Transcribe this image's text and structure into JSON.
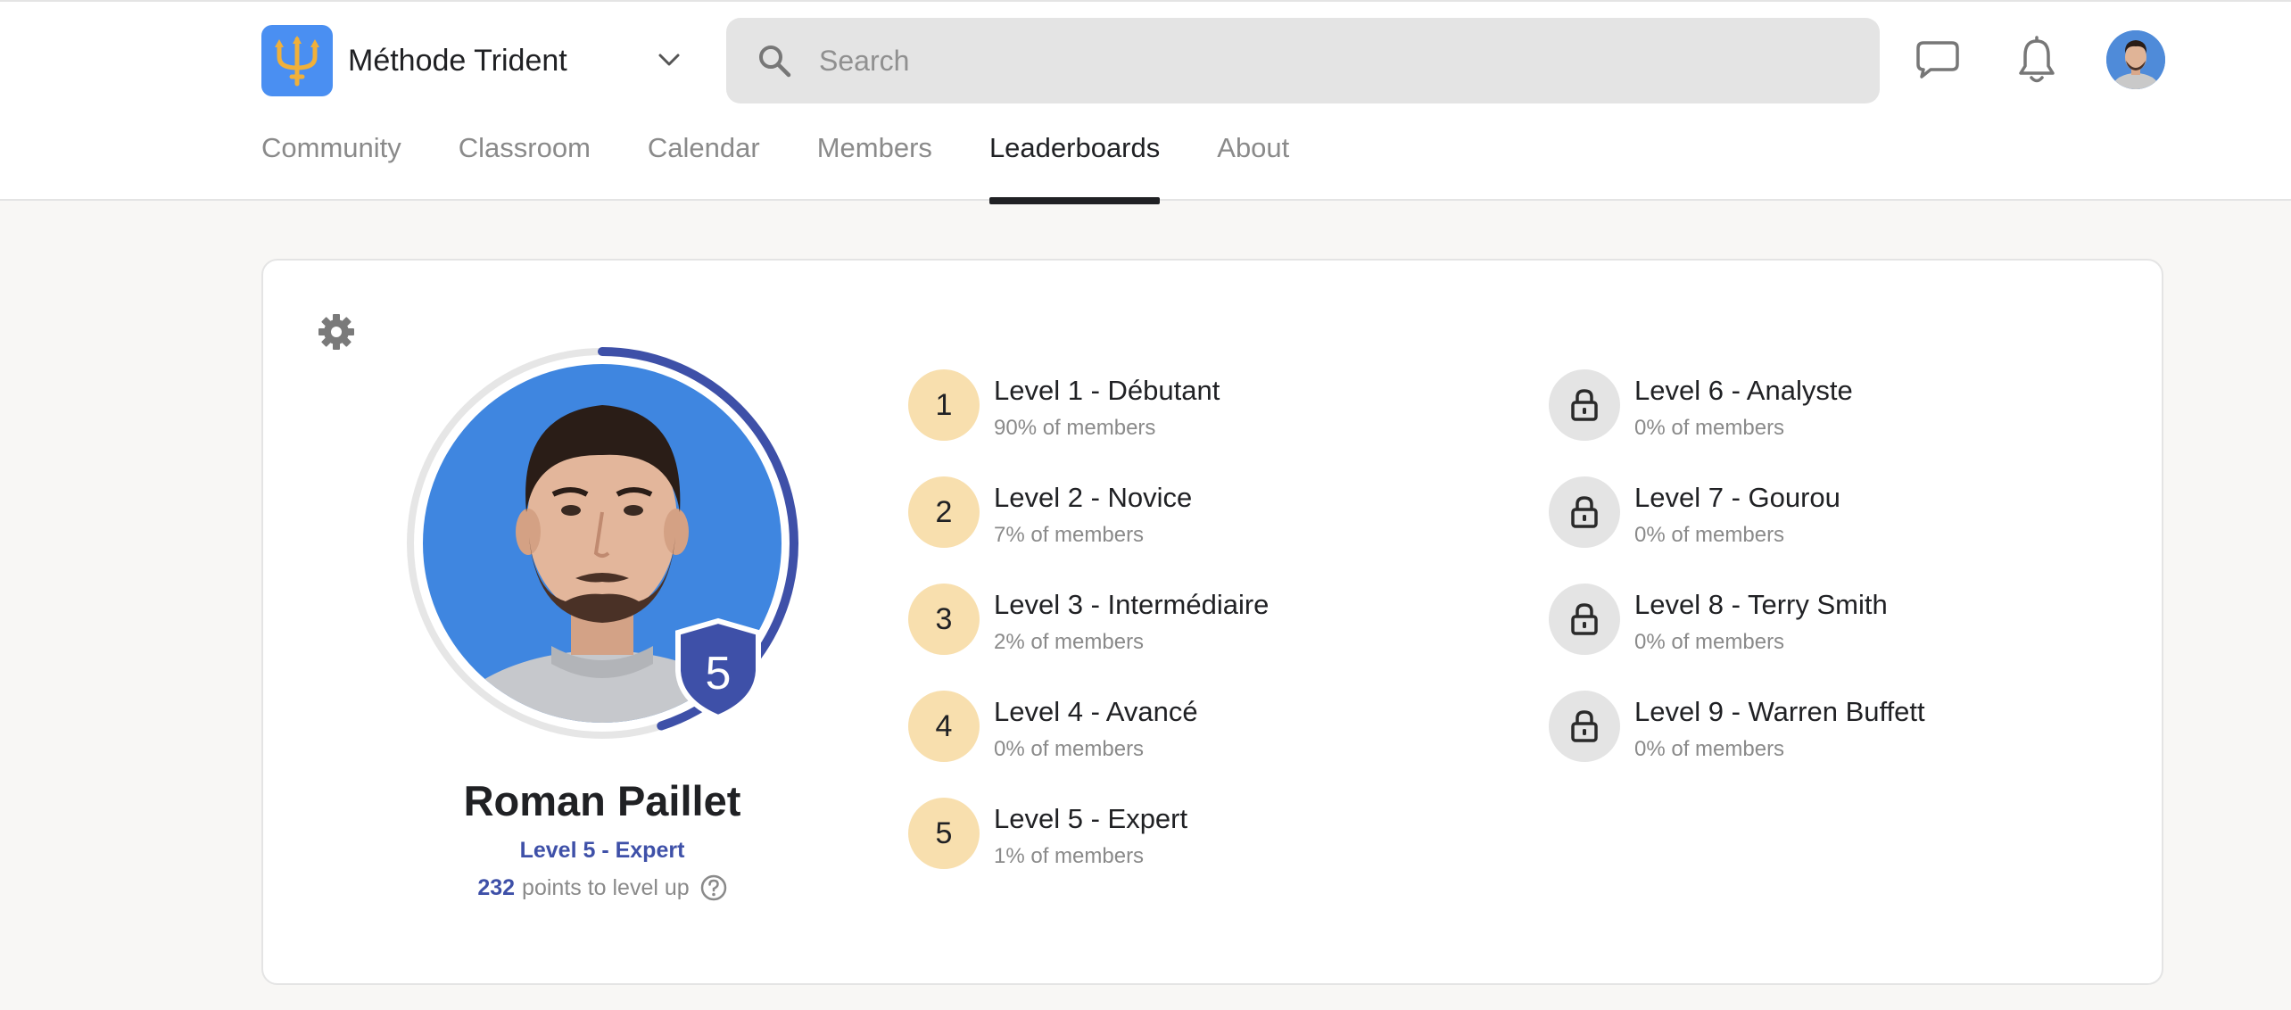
{
  "header": {
    "brand_name": "Méthode Trident",
    "search_placeholder": "Search",
    "colors": {
      "brand_logo_bg": "#4a8ff2",
      "accent": "#3e50a8"
    }
  },
  "tabs": [
    {
      "label": "Community",
      "active": false
    },
    {
      "label": "Classroom",
      "active": false
    },
    {
      "label": "Calendar",
      "active": false
    },
    {
      "label": "Members",
      "active": false
    },
    {
      "label": "Leaderboards",
      "active": true
    },
    {
      "label": "About",
      "active": false
    }
  ],
  "profile": {
    "name": "Roman Paillet",
    "level_number": "5",
    "level_label": "Level 5 - Expert",
    "points": "232",
    "points_suffix": "points to level up",
    "progress_fraction": 0.45
  },
  "levels": [
    {
      "badge": "1",
      "title": "Level 1 - Débutant",
      "members": "90% of members",
      "locked": false
    },
    {
      "badge": "2",
      "title": "Level 2 - Novice",
      "members": "7% of members",
      "locked": false
    },
    {
      "badge": "3",
      "title": "Level 3 - Intermédiaire",
      "members": "2% of members",
      "locked": false
    },
    {
      "badge": "4",
      "title": "Level 4 - Avancé",
      "members": "0% of members",
      "locked": false
    },
    {
      "badge": "5",
      "title": "Level 5 - Expert",
      "members": "1% of members",
      "locked": false
    },
    {
      "badge": "",
      "title": "Level 6 - Analyste",
      "members": "0% of members",
      "locked": true
    },
    {
      "badge": "",
      "title": "Level 7 - Gourou",
      "members": "0% of members",
      "locked": true
    },
    {
      "badge": "",
      "title": "Level 8 - Terry Smith",
      "members": "0% of members",
      "locked": true
    },
    {
      "badge": "",
      "title": "Level 9 - Warren Buffett",
      "members": "0% of members",
      "locked": true
    }
  ],
  "icons": {
    "brand": "trident-icon",
    "dropdown": "chevron-down-icon",
    "search": "search-icon",
    "chat": "chat-icon",
    "notifications": "bell-icon",
    "settings": "gear-icon",
    "help": "question-icon",
    "lock": "lock-icon"
  }
}
